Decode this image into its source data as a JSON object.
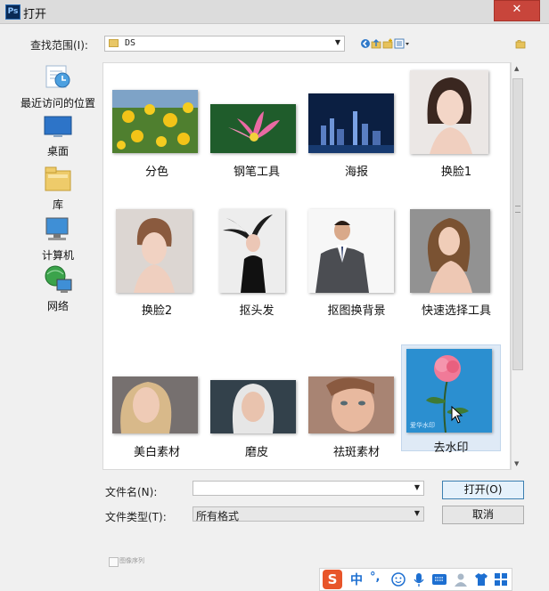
{
  "window": {
    "title": "打开",
    "app_icon": "Ps",
    "close_symbol": "✕"
  },
  "toolbar": {
    "lookin_label": "查找范围(I):",
    "lookin_value": "DS",
    "icons": [
      "back-icon",
      "up-folder-icon",
      "new-folder-icon",
      "view-menu-icon"
    ]
  },
  "places": [
    {
      "label": "最近访问的位置",
      "icon": "recent-places-icon"
    },
    {
      "label": "桌面",
      "icon": "desktop-icon"
    },
    {
      "label": "库",
      "icon": "libraries-icon"
    },
    {
      "label": "计算机",
      "icon": "computer-icon"
    },
    {
      "label": "网络",
      "icon": "network-icon"
    }
  ],
  "files": [
    {
      "name": "分色"
    },
    {
      "name": "钢笔工具"
    },
    {
      "name": "海报"
    },
    {
      "name": "换脸1"
    },
    {
      "name": "换脸2"
    },
    {
      "name": "抠头发"
    },
    {
      "name": "抠图换背景"
    },
    {
      "name": "快速选择工具"
    },
    {
      "name": "美白素材"
    },
    {
      "name": "磨皮"
    },
    {
      "name": "祛斑素材"
    },
    {
      "name": "去水印",
      "selected": true,
      "watermark_text": "爱华水印"
    }
  ],
  "filename": {
    "label": "文件名(N):",
    "value": ""
  },
  "filetype": {
    "label": "文件类型(T):",
    "value": "所有格式"
  },
  "buttons": {
    "open": "打开(O)",
    "cancel": "取消"
  },
  "image_sequence_label": "图像序列",
  "ime_bar": {
    "mode": "中",
    "punct": "°,",
    "icons": [
      "sogou-logo-icon",
      "emoji-icon",
      "microphone-icon",
      "keyboard-icon",
      "user-icon",
      "shirt-icon",
      "grid-icon"
    ]
  },
  "colors": {
    "accent_blue": "#2a8ecf",
    "close_red": "#c8453b",
    "selection": "#dfeaf6"
  }
}
